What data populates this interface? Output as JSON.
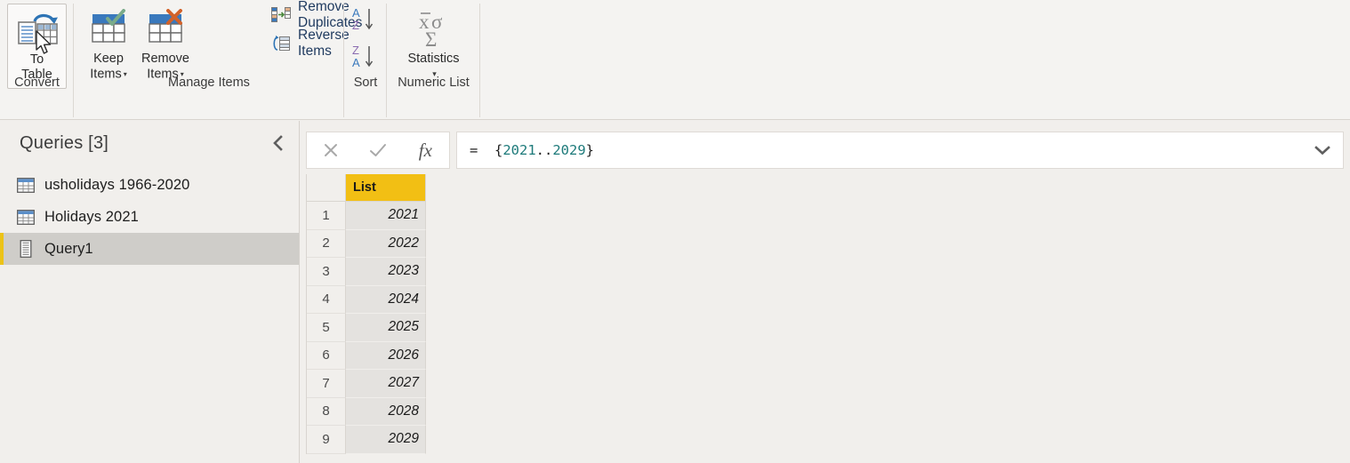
{
  "ribbon": {
    "groups": [
      {
        "name": "convert",
        "label": "Convert",
        "buttons": [
          {
            "name": "to-table",
            "line1": "To",
            "line2": "Table",
            "icon": "to-table-icon",
            "hovered": true
          }
        ]
      },
      {
        "name": "manage-items",
        "label": "Manage Items",
        "buttons": [
          {
            "name": "keep-items",
            "line1": "Keep",
            "line2": "Items",
            "icon": "keep-items-icon",
            "dropdown": "▾"
          },
          {
            "name": "remove-items",
            "line1": "Remove",
            "line2": "Items",
            "icon": "remove-items-icon",
            "dropdown": "▾"
          }
        ],
        "commands": [
          {
            "name": "remove-duplicates",
            "label": "Remove Duplicates",
            "icon": "remove-duplicates-icon"
          },
          {
            "name": "reverse-items",
            "label": "Reverse Items",
            "icon": "reverse-items-icon"
          }
        ]
      },
      {
        "name": "sort",
        "label": "Sort",
        "buttons": [
          {
            "name": "sort-ascending",
            "icon": "sort-az-icon"
          },
          {
            "name": "sort-descending",
            "icon": "sort-za-icon"
          }
        ]
      },
      {
        "name": "numeric-list",
        "label": "Numeric List",
        "buttons": [
          {
            "name": "statistics",
            "line1": "Statistics",
            "line2": "",
            "icon": "statistics-icon",
            "dropdown": "▾"
          }
        ]
      }
    ]
  },
  "sidebar": {
    "title": "Queries [3]",
    "collapse_icon": "chevron-left-icon",
    "items": [
      {
        "name": "usholidays-1966-2020",
        "label": "usholidays 1966-2020",
        "icon": "table-icon",
        "selected": false
      },
      {
        "name": "holidays-2021",
        "label": "Holidays 2021",
        "icon": "table-icon",
        "selected": false
      },
      {
        "name": "query1",
        "label": "Query1",
        "icon": "list-icon",
        "selected": true
      }
    ]
  },
  "formula_bar": {
    "cancel_icon": "close-icon",
    "accept_icon": "check-icon",
    "fx_label": "fx",
    "expand_icon": "chevron-down-icon",
    "formula_prefix": "=  {",
    "formula_start": "2021",
    "formula_range": "..",
    "formula_end": "2029",
    "formula_suffix": "}"
  },
  "grid": {
    "column_header": "List",
    "rows": [
      {
        "index": "1",
        "value": "2021"
      },
      {
        "index": "2",
        "value": "2022"
      },
      {
        "index": "3",
        "value": "2023"
      },
      {
        "index": "4",
        "value": "2024"
      },
      {
        "index": "5",
        "value": "2025"
      },
      {
        "index": "6",
        "value": "2026"
      },
      {
        "index": "7",
        "value": "2027"
      },
      {
        "index": "8",
        "value": "2028"
      },
      {
        "index": "9",
        "value": "2029"
      }
    ]
  },
  "colors": {
    "header_gold": "#f2bf14",
    "selection_accent": "#ecc318",
    "formula_number": "#1d7a7a",
    "command_text": "#1f3a5f"
  }
}
